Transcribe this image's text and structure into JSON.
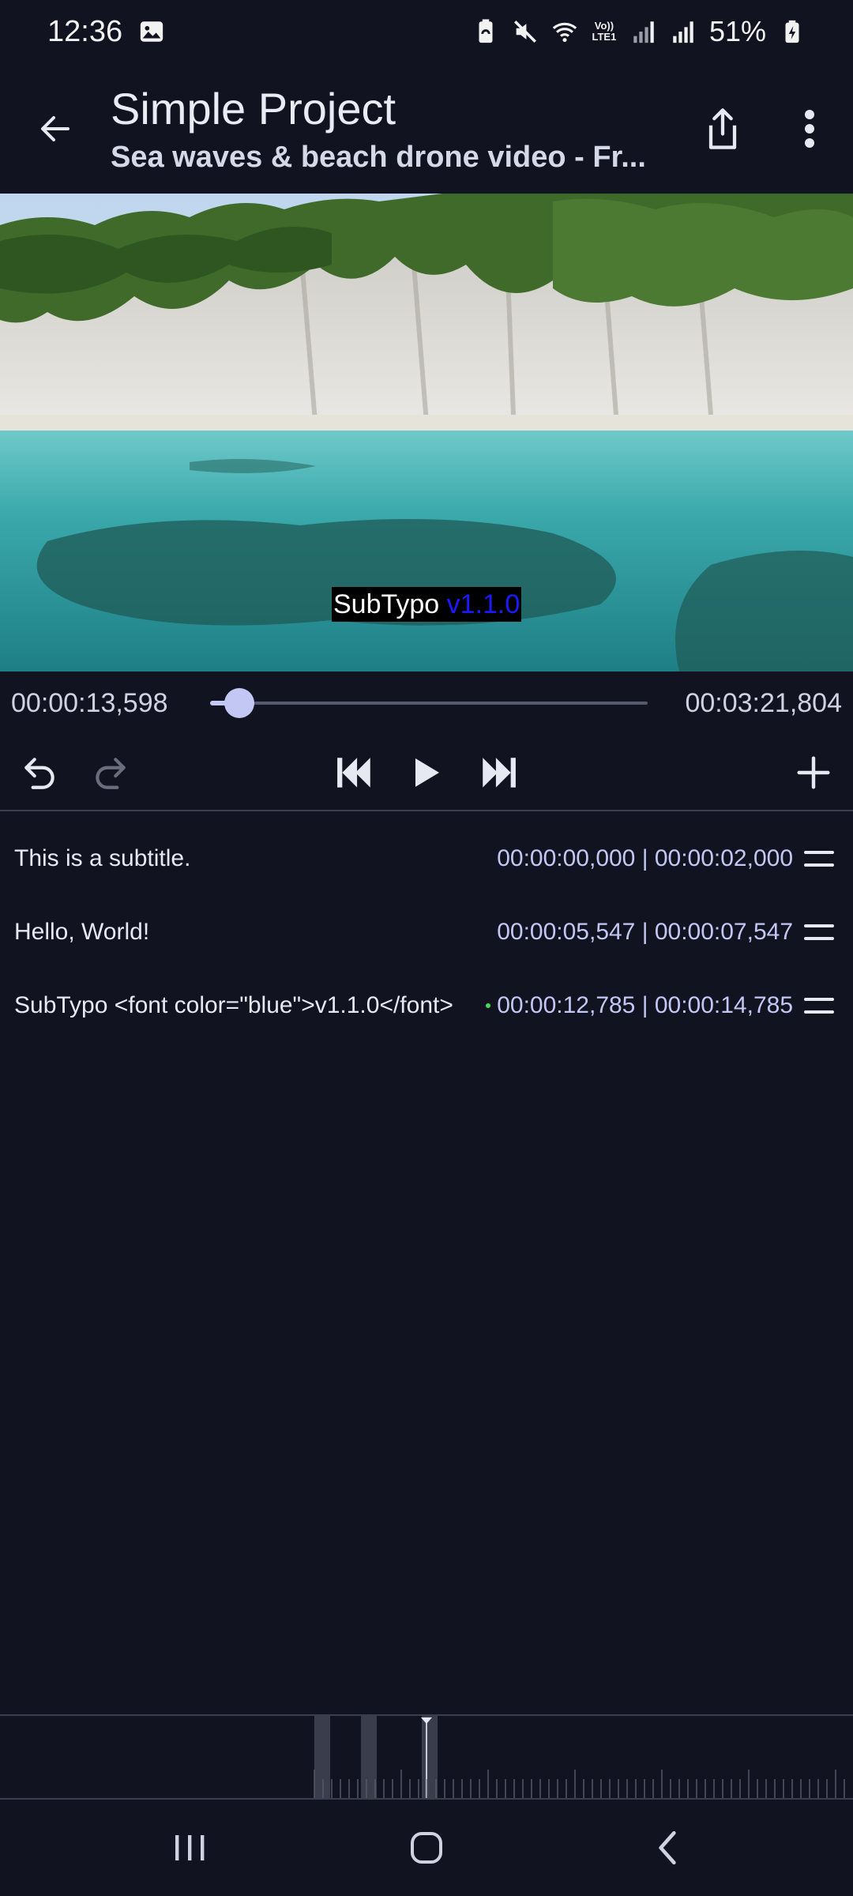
{
  "status": {
    "time": "12:36",
    "battery": "51%",
    "icons": [
      "gallery-icon",
      "battery-saver-icon",
      "mute-icon",
      "wifi-icon",
      "volte-icon",
      "signal-icon",
      "signal-icon",
      "battery-icon"
    ],
    "volte_label": "Vo)) LTE1"
  },
  "appbar": {
    "title": "Simple Project",
    "subtitle": "Sea waves & beach drone video - Fr...",
    "icons": [
      "back-arrow-icon",
      "share-icon",
      "more-vert-icon"
    ]
  },
  "video": {
    "caption_white": "SubTypo ",
    "caption_blue": "v1.1.0"
  },
  "player": {
    "current_time": "00:00:13,598",
    "total_time": "00:03:21,804",
    "progress": 0.0674
  },
  "controls": {
    "icons": [
      "undo-icon",
      "redo-icon",
      "skip-previous-icon",
      "play-icon",
      "skip-next-icon",
      "add-icon"
    ]
  },
  "subtitles": [
    {
      "text": "This is a subtitle.",
      "times": "00:00:00,000 | 00:00:02,000",
      "active": false
    },
    {
      "text": "Hello, World!",
      "times": "00:00:05,547 | 00:00:07,547",
      "active": false
    },
    {
      "text": "SubTypo <font color=\"blue\">v1.1.0</font>",
      "times": "00:00:12,785 | 00:00:14,785",
      "active": true
    }
  ],
  "colors": {
    "background": "#111320",
    "accent": "#c3c7f4",
    "active_dot": "#3ddc5a",
    "caption_blue": "#1a1aff"
  },
  "navbar": {
    "icons": [
      "recents-icon",
      "home-icon",
      "back-icon"
    ]
  }
}
